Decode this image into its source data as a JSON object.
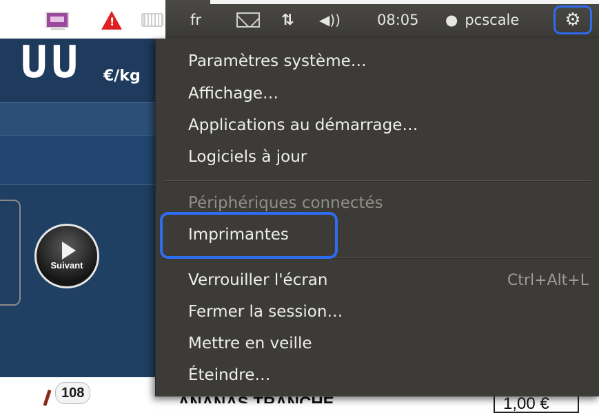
{
  "panel": {
    "language": "fr",
    "clock": "08:05",
    "username": "pcscale",
    "icons": [
      "display-icon",
      "warning-icon",
      "keyboard-icon",
      "mail-icon",
      "network-icon",
      "volume-icon",
      "user-icon",
      "gear-icon"
    ],
    "highlight_color": "#2f6df0"
  },
  "system_menu": {
    "items": [
      {
        "label": "Paramètres système…"
      },
      {
        "label": "Affichage…"
      },
      {
        "label": "Applications au démarrage…"
      },
      {
        "label": "Logiciels à jour"
      },
      {
        "label": "Périphériques connectés",
        "disabled": true
      },
      {
        "label": "Imprimantes",
        "highlighted": true
      },
      {
        "label": "Verrouiller l'écran",
        "shortcut": "Ctrl+Alt+L"
      },
      {
        "label": "Fermer la session…"
      },
      {
        "label": "Mettre en veille"
      },
      {
        "label": "Éteindre…"
      }
    ]
  },
  "background_app": {
    "display_value": "UU",
    "price_unit": "€/kg",
    "next_button_label": "Suivant",
    "count_badge": "108",
    "bottom_price": "1,00 €",
    "bottom_title": "ANANAS TRANCHE"
  }
}
